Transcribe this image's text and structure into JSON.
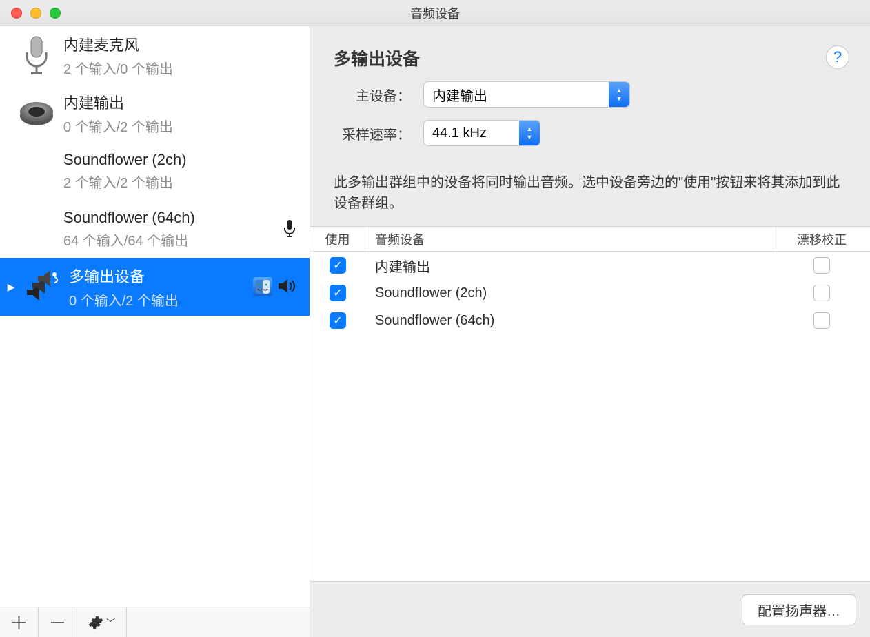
{
  "window": {
    "title": "音频设备"
  },
  "sidebar": {
    "devices": [
      {
        "name": "内建麦克风",
        "sub": "2 个输入/0 个输出"
      },
      {
        "name": "内建输出",
        "sub": "0 个输入/2 个输出"
      },
      {
        "name": "Soundflower (2ch)",
        "sub": "2 个输入/2 个输出"
      },
      {
        "name": "Soundflower (64ch)",
        "sub": "64 个输入/64 个输出"
      },
      {
        "name": "多输出设备",
        "sub": "0 个输入/2 个输出"
      }
    ],
    "add": "＋",
    "remove": "－"
  },
  "main": {
    "title": "多输出设备",
    "master_label": "主设备：",
    "master_value": "内建输出",
    "rate_label": "采样速率：",
    "rate_value": "44.1 kHz",
    "description": "此多输出群组中的设备将同时输出音频。选中设备旁边的\"使用\"按钮来将其添加到此设备群组。",
    "help": "?",
    "table": {
      "col_use": "使用",
      "col_name": "音频设备",
      "col_drift": "漂移校正",
      "rows": [
        {
          "name": "内建输出",
          "use": true,
          "drift": false
        },
        {
          "name": "Soundflower (2ch)",
          "use": true,
          "drift": false
        },
        {
          "name": "Soundflower (64ch)",
          "use": true,
          "drift": false
        }
      ]
    },
    "config_button": "配置扬声器…"
  }
}
